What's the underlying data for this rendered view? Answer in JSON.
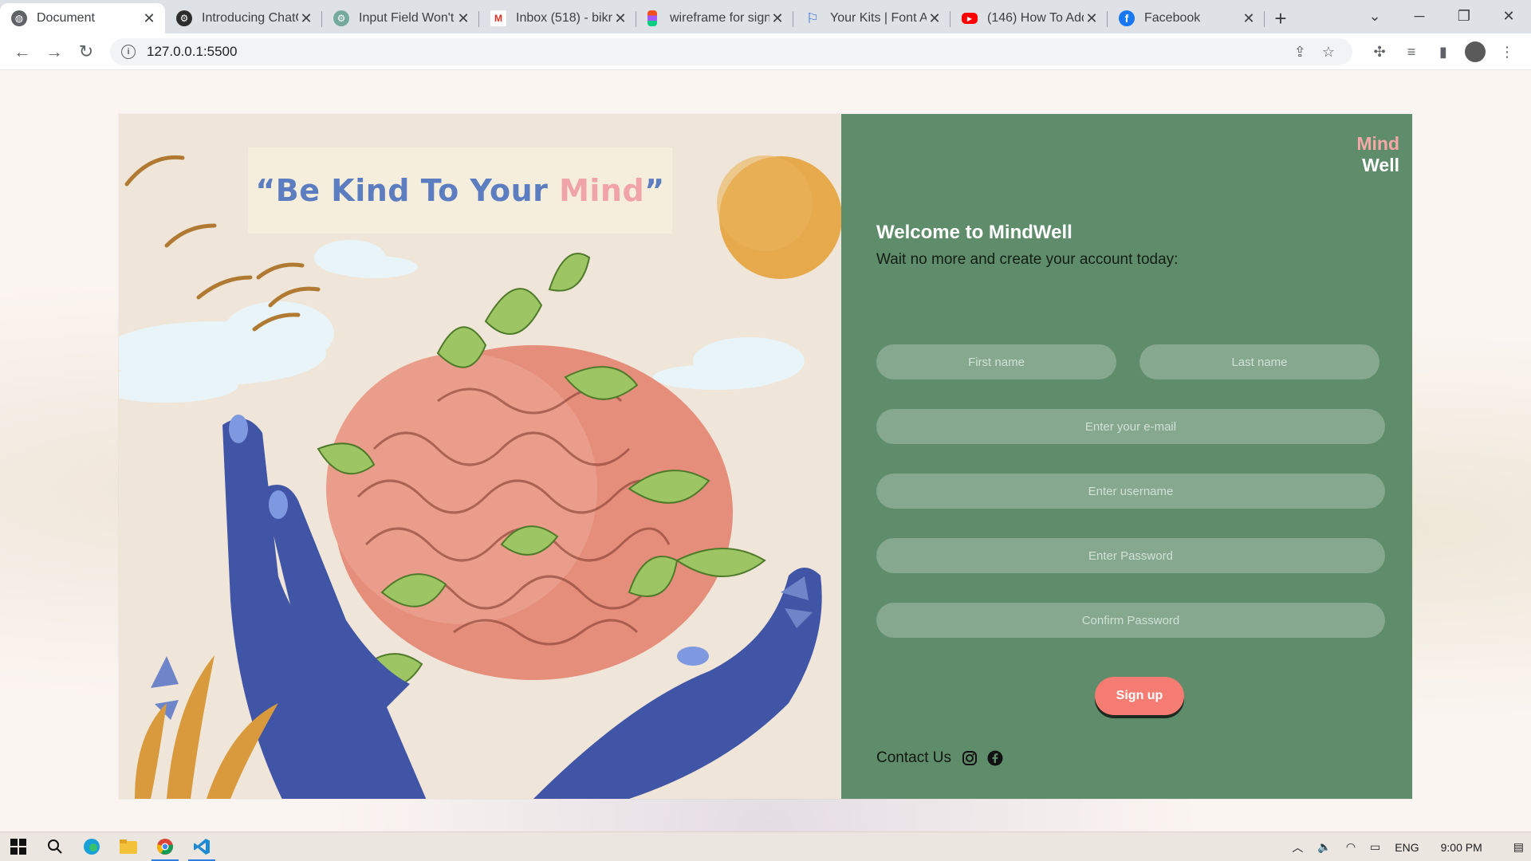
{
  "browser": {
    "tabs": [
      {
        "title": "Document",
        "icon": "globe-icon",
        "active": true
      },
      {
        "title": "Introducing ChatG",
        "icon": "openai-icon"
      },
      {
        "title": "Input Field Won't",
        "icon": "chatgpt-icon"
      },
      {
        "title": "Inbox (518) - bikr",
        "icon": "gmail-icon"
      },
      {
        "title": "wireframe for sign",
        "icon": "figma-icon"
      },
      {
        "title": "Your Kits | Font Aw",
        "icon": "fontawesome-flag-icon"
      },
      {
        "title": "(146) How To Add",
        "icon": "youtube-icon"
      },
      {
        "title": "Facebook",
        "icon": "facebook-icon"
      }
    ],
    "url": "127.0.0.1:5500"
  },
  "hero": {
    "quote_open": "“Be Kind To Your ",
    "quote_accent": "Mind",
    "quote_close": "”"
  },
  "brand": {
    "line1": "Mind",
    "line2": "Well"
  },
  "form": {
    "heading": "Welcome to MindWell",
    "subheading": "Wait no more and create your account today:",
    "first_name_placeholder": "First name",
    "last_name_placeholder": "Last name",
    "email_placeholder": "Enter your e-mail",
    "username_placeholder": "Enter username",
    "password_placeholder": "Enter Password",
    "confirm_placeholder": "Confirm Password",
    "submit_label": "Sign up"
  },
  "footer": {
    "contact_label": "Contact Us",
    "social_icons": [
      "instagram-icon",
      "facebook-icon"
    ]
  },
  "taskbar": {
    "language": "ENG",
    "time": "9:00 PM"
  },
  "colors": {
    "form_bg": "#5f8c6a",
    "field_bg": "#85a88f",
    "button": "#f47c73",
    "brand_pink": "#f6a8a6",
    "quote_blue": "#5c7ec0"
  }
}
